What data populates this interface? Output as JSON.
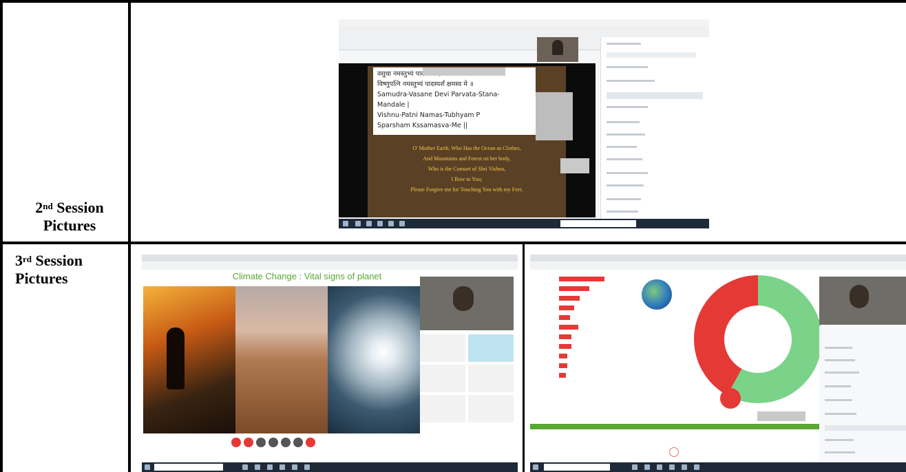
{
  "rows": [
    {
      "label_ordinal": "2",
      "label_sup": "nd",
      "label_rest": "Session",
      "label_line2": "Pictures"
    },
    {
      "label_ordinal": "3",
      "label_sup": "rd",
      "label_rest": "Session",
      "label_line2": "Pictures"
    }
  ],
  "session2_shot": {
    "slide_lines_sanskrit": [
      "वसुधा नमस्तुभ्यं पादस्पर्शं क्षमस्व मे",
      "विष्णुपत्नि नमस्तुभ्यं पादस्पर्शं क्षमस्व मे ॥",
      "Samudra-Vasane Devi Parvata-Stana-",
      "Mandale |",
      "Vishnu-Patni Namas-Tubhyam P",
      "Sparsham Kssamasva-Me ||"
    ],
    "slide_lines_english": [
      "O' Mother Earth, Who Has the Ocean as Clothes,",
      "And Mountains and Forest on her body,",
      "Who is the Consort of Shri Vishnu,",
      "I Bow to You;",
      "Please Forgive me for Touching You with my Feet."
    ]
  },
  "session3_shot_a": {
    "slide_title": "Climate Change : Vital signs of planet"
  },
  "colors": {
    "border": "#000000",
    "slide_brown": "#5a4025",
    "slide_yellow": "#f2c94c",
    "chart_red": "#e53935",
    "chart_green": "#7bd389",
    "climate_green": "#5aa832"
  }
}
